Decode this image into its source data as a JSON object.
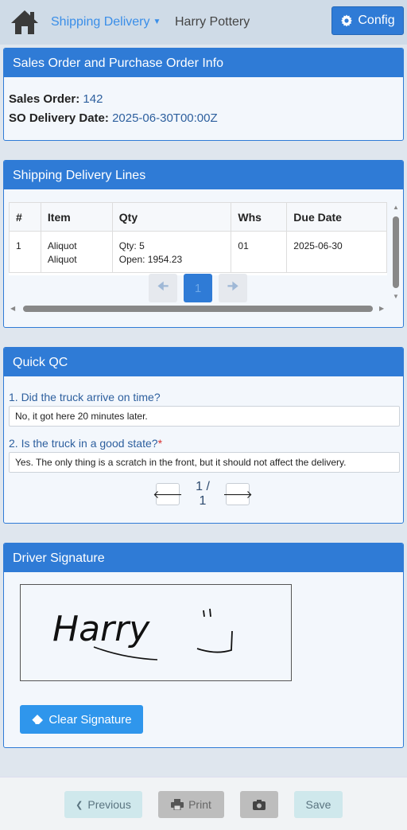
{
  "header": {
    "module_label": "Shipping Delivery",
    "company_name": "Harry Pottery",
    "config_label": "Config"
  },
  "sales_order_card": {
    "title": "Sales Order and Purchase Order Info",
    "so_label": "Sales Order:",
    "so_value": "142",
    "date_label": "SO Delivery Date:",
    "date_value": "2025-06-30T00:00Z"
  },
  "lines_card": {
    "title": "Shipping Delivery Lines",
    "columns": [
      "#",
      "Item",
      "Qty",
      "Whs",
      "Due Date"
    ],
    "rows": [
      {
        "num": "1",
        "item_line1": "Aliquot",
        "item_line2": "Aliquot",
        "qty_line1": "Qty: 5",
        "qty_line2": "Open: 1954.23",
        "whs": "01",
        "due_date": "2025-06-30"
      }
    ],
    "pager": {
      "current_page": "1"
    }
  },
  "qc_card": {
    "title": "Quick QC",
    "questions": [
      {
        "label": "1. Did the truck arrive on time?",
        "required_mark": "",
        "answer": "No, it got here 20 minutes later."
      },
      {
        "label": "2. Is the truck in a good state?",
        "required_mark": "*",
        "answer": "Yes. The only thing is a scratch in the front, but it should not affect the delivery."
      }
    ],
    "pager_text": "1 / 1"
  },
  "signature_card": {
    "title": "Driver Signature",
    "signature_text": "Harry",
    "clear_label": "Clear Signature"
  },
  "footer": {
    "previous_label": "Previous",
    "print_label": "Print",
    "save_label": "Save"
  },
  "colors": {
    "accent": "#2f7bd6",
    "link": "#3a8ee8",
    "required": "#d9302f"
  }
}
